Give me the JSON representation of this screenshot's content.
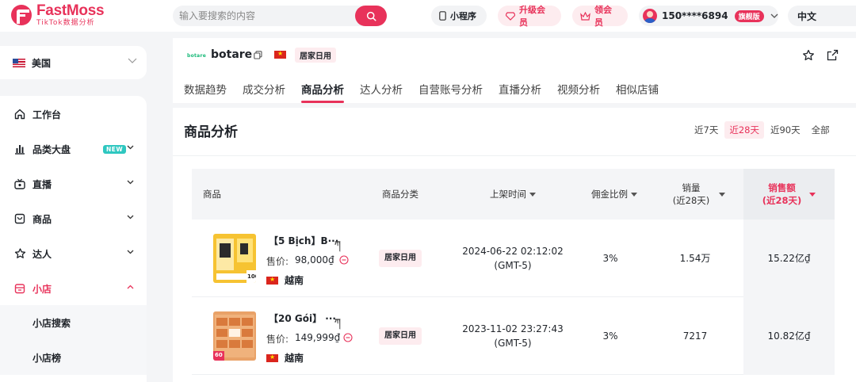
{
  "brand": {
    "name": "FastMoss",
    "tagline": "TikTok数据分析",
    "color": "#e8325a"
  },
  "search": {
    "placeholder": "输入要搜索的内容"
  },
  "topnav": {
    "mini_program": "小程序",
    "upgrade": "升级会员",
    "coupon": "领会员",
    "account": "150****6894",
    "plan_badge": "旗舰版",
    "language": "中文"
  },
  "region": {
    "label": "美国"
  },
  "sidebar": {
    "items": [
      {
        "label": "工作台",
        "icon": "monitor-icon"
      },
      {
        "label": "品类大盘",
        "icon": "bar-chart-icon",
        "badge": "NEW"
      },
      {
        "label": "直播",
        "icon": "live-icon"
      },
      {
        "label": "商品",
        "icon": "bag-icon"
      },
      {
        "label": "达人",
        "icon": "star-person-icon"
      },
      {
        "label": "小店",
        "icon": "store-icon"
      }
    ],
    "sub_items": [
      "小店搜索",
      "小店榜"
    ]
  },
  "shop": {
    "logo_text": "botare",
    "name": "botare",
    "category": "居家日用",
    "tabs": [
      "数据趋势",
      "成交分析",
      "商品分析",
      "达人分析",
      "自营账号分析",
      "直播分析",
      "视频分析",
      "相似店铺"
    ],
    "active_tab": "商品分析"
  },
  "section": {
    "title": "商品分析",
    "ranges": [
      "近7天",
      "近28天",
      "近90天",
      "全部"
    ],
    "active_range": "近28天"
  },
  "table": {
    "headers": {
      "product": "商品",
      "category": "商品分类",
      "listed_time": "上架时间",
      "commission": "佣金比例",
      "sales_line1": "销量",
      "sales_line2": "(近28天)",
      "revenue_line1": "销售额",
      "revenue_line2": "(近28天)"
    },
    "rows": [
      {
        "name": "【5 Bịch】B···",
        "price_label": "售价:",
        "price": "98,000₫",
        "country": "越南",
        "category": "居家日用",
        "listed_date": "2024-06-22 02:12:02",
        "listed_tz": "(GMT-5)",
        "commission": "3%",
        "sales": "1.54万",
        "revenue": "15.22亿₫",
        "thumb_label": "100"
      },
      {
        "name": "【20 Gói】 ···",
        "price_label": "售价:",
        "price": "149,999₫",
        "country": "越南",
        "category": "居家日用",
        "listed_date": "2023-11-02 23:27:43",
        "listed_tz": "(GMT-5)",
        "commission": "3%",
        "sales": "7217",
        "revenue": "10.82亿₫",
        "thumb_label": "60"
      }
    ]
  }
}
